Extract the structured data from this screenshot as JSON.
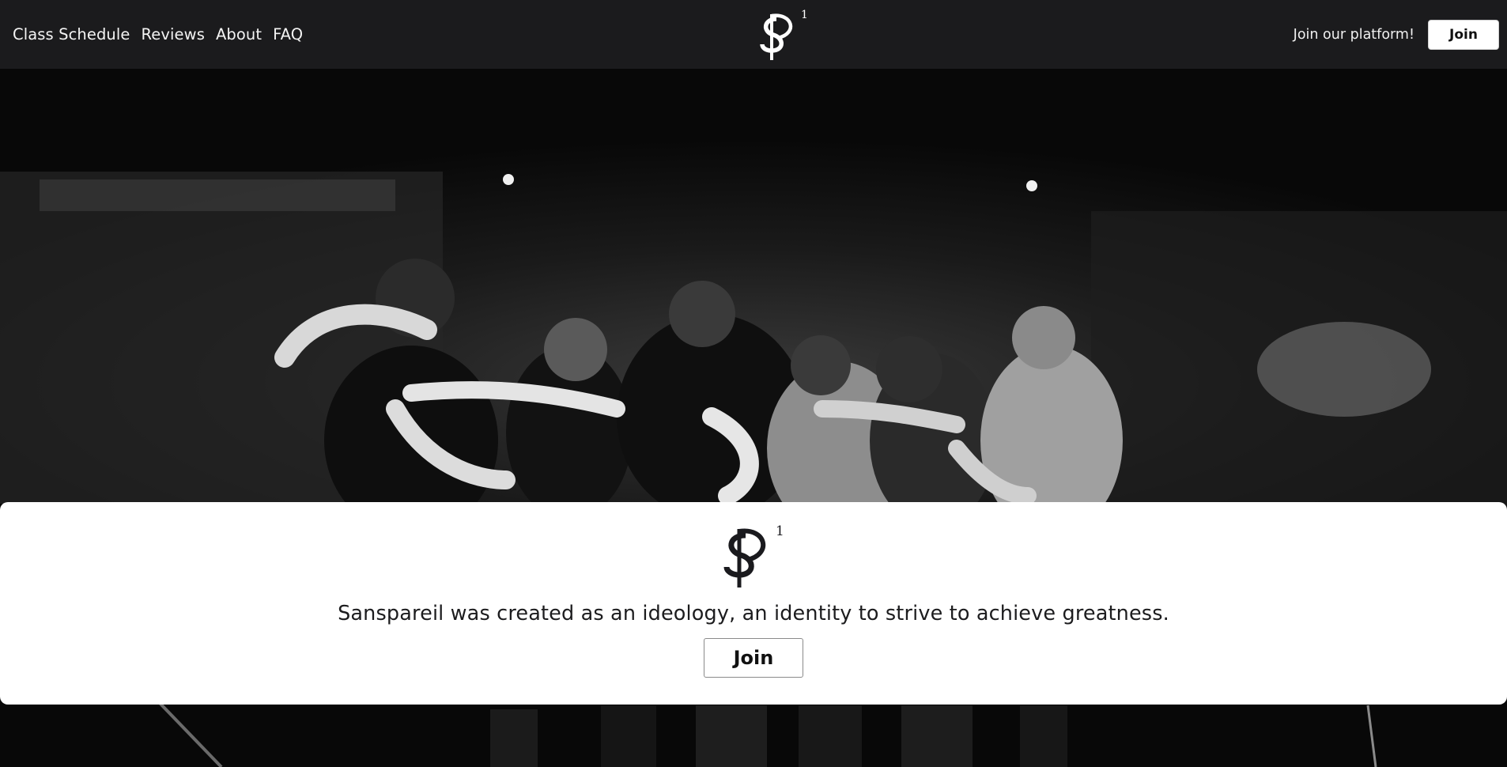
{
  "nav": {
    "links": [
      "Class Schedule",
      "Reviews",
      "About",
      "FAQ"
    ],
    "logo": {
      "letters": "SP",
      "superscript": "1"
    },
    "cta_text": "Join our platform!",
    "join_label": "Join"
  },
  "hero": {
    "image": "black-and-white-team-huddle-on-stage-photo"
  },
  "card": {
    "logo": {
      "letters": "SP",
      "superscript": "1"
    },
    "tagline": "Sanspareil was created as an ideology, an identity to strive to achieve greatness.",
    "join_label": "Join"
  },
  "colors": {
    "navbar_bg": "#1b1b1d",
    "card_bg": "#ffffff",
    "text_dark": "#1c1c1e",
    "text_light": "#f4f4f4"
  }
}
